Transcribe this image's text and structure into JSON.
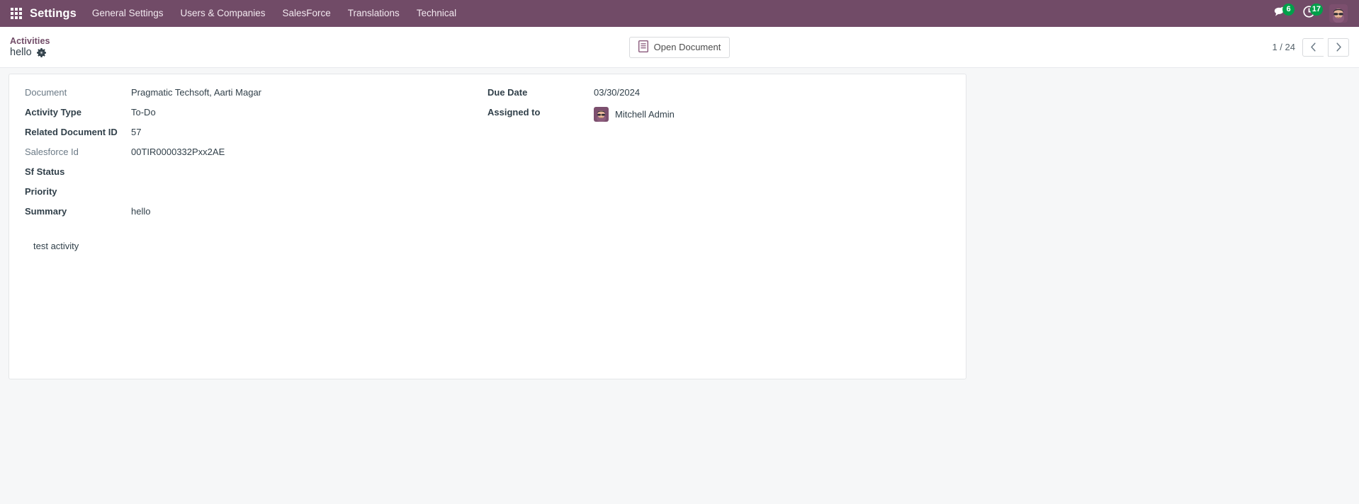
{
  "navbar": {
    "apps_icon": "apps-grid-icon",
    "brand": "Settings",
    "menu": [
      {
        "label": "General Settings"
      },
      {
        "label": "Users & Companies"
      },
      {
        "label": "SalesForce"
      },
      {
        "label": "Translations"
      },
      {
        "label": "Technical"
      }
    ],
    "systray": {
      "messages_icon": "messages-icon",
      "messages_count": "6",
      "activities_icon": "activity-clock-icon",
      "activities_count": "17",
      "avatar_icon": "user-avatar"
    },
    "color": "#714B67",
    "badge_color": "#00A04A"
  },
  "control_panel": {
    "breadcrumb_parent": "Activities",
    "breadcrumb_current": "hello",
    "gear_icon": "gear-icon",
    "open_document": {
      "label": "Open Document",
      "icon": "document-icon"
    },
    "pager": {
      "value": "1 / 24",
      "prev_icon": "chevron-left-icon",
      "next_icon": "chevron-right-icon"
    }
  },
  "form": {
    "left_fields": [
      {
        "label": "Document",
        "value": "Pragmatic Techsoft, Aarti Magar",
        "bold": false
      },
      {
        "label": "Activity Type",
        "value": "To-Do",
        "bold": true
      },
      {
        "label": "Related Document ID",
        "value": "57",
        "bold": true
      },
      {
        "label": "Salesforce Id",
        "value": "00TIR0000332Pxx2AE",
        "bold": false
      },
      {
        "label": "Sf Status",
        "value": "",
        "bold": true
      },
      {
        "label": "Priority",
        "value": "",
        "bold": true
      },
      {
        "label": "Summary",
        "value": "hello",
        "bold": true
      }
    ],
    "right_fields": [
      {
        "label": "Due Date",
        "value": "03/30/2024",
        "bold": true
      },
      {
        "label": "Assigned to",
        "value": "Mitchell Admin",
        "bold": true,
        "avatar": "user-avatar"
      }
    ],
    "note": "test activity"
  }
}
